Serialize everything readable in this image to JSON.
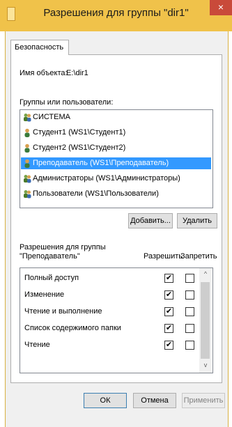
{
  "window": {
    "title": "Разрешения для группы \"dir1\"",
    "close_glyph": "×"
  },
  "tabs": [
    {
      "label": "Безопасность"
    }
  ],
  "object_label": "Имя объекта:",
  "object_value": "E:\\dir1",
  "groups_label": "Группы или пользователи:",
  "principals": [
    {
      "label": "СИСТЕМА",
      "icon": "group-icon",
      "selected": false
    },
    {
      "label": "Студент1 (WS1\\Студент1)",
      "icon": "user-icon",
      "selected": false
    },
    {
      "label": "Студент2 (WS1\\Студент2)",
      "icon": "user-icon",
      "selected": false
    },
    {
      "label": "Преподаватель (WS1\\Преподаватель)",
      "icon": "user-icon",
      "selected": true
    },
    {
      "label": "Администраторы (WS1\\Администраторы)",
      "icon": "group-icon",
      "selected": false
    },
    {
      "label": "Пользователи (WS1\\Пользователи)",
      "icon": "group-icon",
      "selected": false
    }
  ],
  "buttons": {
    "add": "Добавить...",
    "remove": "Удалить",
    "ok": "ОК",
    "cancel": "Отмена",
    "apply": "Применить"
  },
  "permissions_header": {
    "line1": "Разрешения для группы",
    "line2": "\"Преподаватель\"",
    "allow": "Разрешить",
    "deny": "Запретить"
  },
  "permissions": [
    {
      "label": "Полный доступ",
      "allow": true,
      "deny": false
    },
    {
      "label": "Изменение",
      "allow": true,
      "deny": false
    },
    {
      "label": "Чтение и выполнение",
      "allow": true,
      "deny": false
    },
    {
      "label": "Список содержимого папки",
      "allow": true,
      "deny": false
    },
    {
      "label": "Чтение",
      "allow": true,
      "deny": false
    }
  ],
  "scrollbar": {
    "up": "^",
    "down": "v"
  },
  "colors": {
    "titlebar": "#f0c24a",
    "selection": "#3399ff",
    "close": "#c94a3a"
  }
}
